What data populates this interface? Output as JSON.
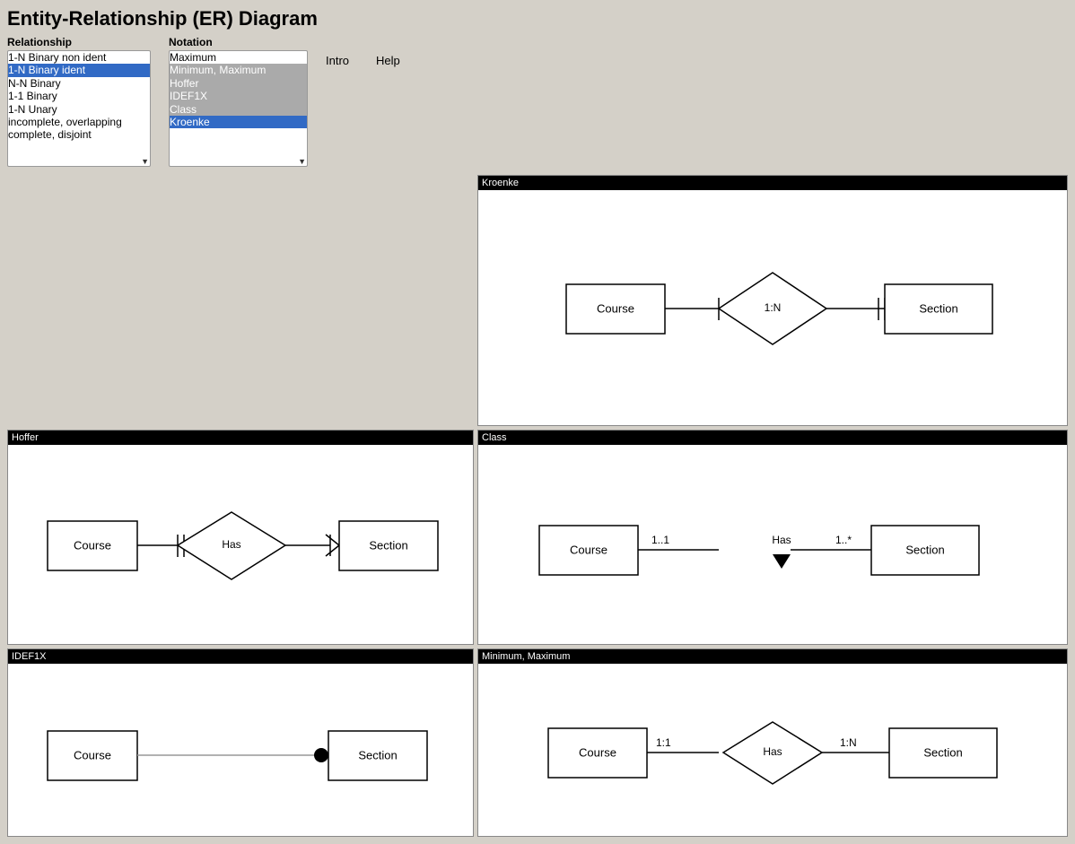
{
  "title": "Entity-Relationship (ER) Diagram",
  "relationship_label": "Relationship",
  "notation_label": "Notation",
  "nav": {
    "intro": "Intro",
    "help": "Help"
  },
  "relationships": [
    {
      "value": "1n-binary-non-ident",
      "label": "1-N Binary non ident",
      "selected": false
    },
    {
      "value": "1n-binary-ident",
      "label": "1-N Binary ident",
      "selected": true
    },
    {
      "value": "nn-binary",
      "label": "N-N Binary",
      "selected": false
    },
    {
      "value": "11-binary",
      "label": "1-1 Binary",
      "selected": false
    },
    {
      "value": "1n-unary",
      "label": "1-N Unary",
      "selected": false
    },
    {
      "value": "incomplete-overlapping",
      "label": "incomplete, overlapping",
      "selected": false
    },
    {
      "value": "complete-disjoint",
      "label": "complete, disjoint",
      "selected": false
    }
  ],
  "notations": [
    {
      "value": "maximum",
      "label": "Maximum",
      "selected": false
    },
    {
      "value": "min-max",
      "label": "Minimum, Maximum",
      "selected": false
    },
    {
      "value": "hoffer",
      "label": "Hoffer",
      "selected": false
    },
    {
      "value": "idef1x",
      "label": "IDEF1X",
      "selected": false
    },
    {
      "value": "class",
      "label": "Class",
      "selected": false
    },
    {
      "value": "kroenke",
      "label": "Kroenke",
      "selected": true
    }
  ],
  "diagrams": {
    "kroenke": {
      "title": "Kroenke",
      "course": "Course",
      "section": "Section",
      "label": "1:N"
    },
    "hoffer": {
      "title": "Hoffer",
      "course": "Course",
      "section": "Section",
      "rel": "Has"
    },
    "class": {
      "title": "Class",
      "course": "Course",
      "section": "Section",
      "rel": "Has",
      "left_mult": "1..1",
      "right_mult": "1..*"
    },
    "idef1x": {
      "title": "IDEF1X",
      "course": "Course",
      "section": "Section"
    },
    "minmax": {
      "title": "Minimum, Maximum",
      "course": "Course",
      "section": "Section",
      "rel": "Has",
      "left_mult": "1:1",
      "right_mult": "1:N"
    }
  }
}
